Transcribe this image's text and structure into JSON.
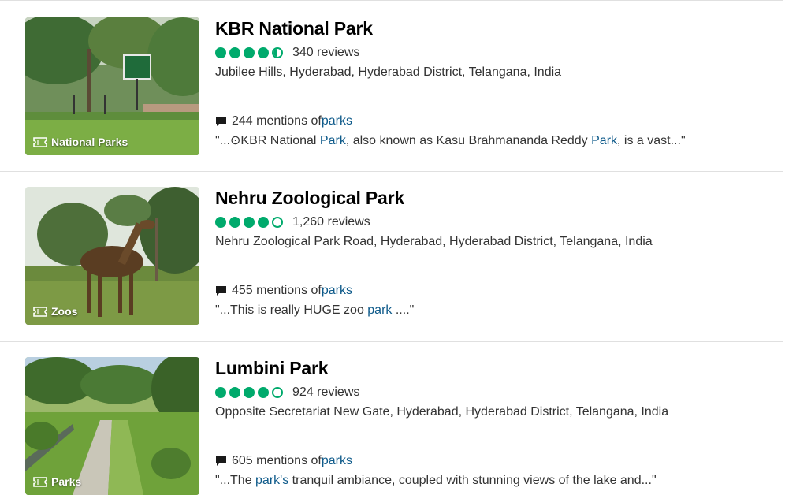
{
  "results": [
    {
      "title": "KBR National Park",
      "rating": 4.5,
      "reviews": "340 reviews",
      "address": "Jubilee Hills, Hyderabad, Hyderabad District, Telangana, India",
      "category": "National Parks",
      "mentions_prefix": "244 mentions of ",
      "mentions_link": "parks",
      "quote_parts": [
        "\"...⊙KBR National ",
        "Park",
        ", also known as Kasu Brahmananda Reddy ",
        "Park",
        ", is a vast...\""
      ]
    },
    {
      "title": "Nehru Zoological Park",
      "rating": 4,
      "reviews": "1,260 reviews",
      "address": "Nehru Zoological Park Road, Hyderabad, Hyderabad District, Telangana, India",
      "category": "Zoos",
      "mentions_prefix": "455 mentions of ",
      "mentions_link": "parks",
      "quote_parts": [
        "\"...This is really HUGE zoo ",
        "park",
        " ....\""
      ]
    },
    {
      "title": "Lumbini Park",
      "rating": 4,
      "reviews": "924 reviews",
      "address": "Opposite Secretariat New Gate, Hyderabad, Hyderabad District, Telangana, India",
      "category": "Parks",
      "mentions_prefix": "605 mentions of ",
      "mentions_link": "parks",
      "quote_parts": [
        "\"...The ",
        "park's",
        " tranquil ambiance, coupled with stunning views of the lake and...\""
      ]
    }
  ],
  "colors": {
    "bubble": "#00aa6c",
    "link": "#0e5a8a"
  },
  "icons": {
    "category": "ticket-icon",
    "mentions": "comment-icon"
  }
}
